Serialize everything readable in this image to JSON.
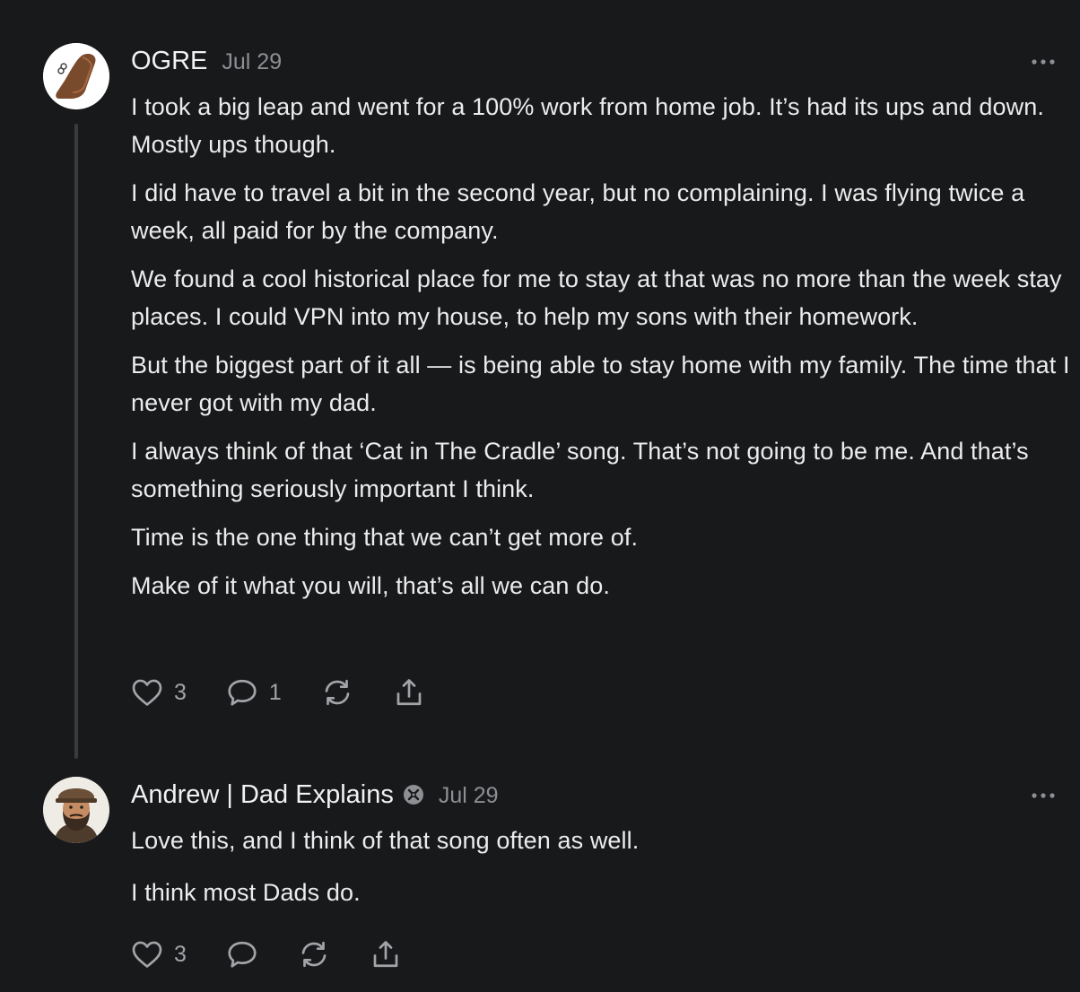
{
  "comments": [
    {
      "author": "OGRE",
      "date": "Jul 29",
      "avatar_icon": "leather-boot-logo-icon",
      "paragraphs": [
        "I took a big leap and went for a 100% work from home job. It’s had its ups and down. Mostly ups though.",
        "I did have to travel a bit in the second year, but no complaining. I was flying twice a week, all paid for by the company.",
        "We found a cool historical place for me to stay at that was no more than the week stay places. I could VPN into my house, to help my sons with their homework.",
        "But the biggest part of it all — is being able to stay home with my family. The time that I never got with my dad.",
        "I always think of that ‘Cat in The Cradle’ song. That’s not going to be me. And that’s something seriously important I think.",
        "Time is the one thing that we can’t get more of.",
        "Make of it what you will, that’s all we can do."
      ],
      "likes": "3",
      "replies": "1"
    },
    {
      "author": "Andrew | Dad Explains",
      "date": "Jul 29",
      "avatar_icon": "bearded-man-avatar-icon",
      "badge_icon": "verified-badge-icon",
      "paragraphs": [
        "Love this, and I think of that song often as well.",
        "I think most Dads do."
      ],
      "likes": "3",
      "replies": ""
    }
  ],
  "colors": {
    "background": "#18191b",
    "text": "#ececec",
    "muted": "#8e8e93",
    "thread_line": "#3a3b3d"
  }
}
